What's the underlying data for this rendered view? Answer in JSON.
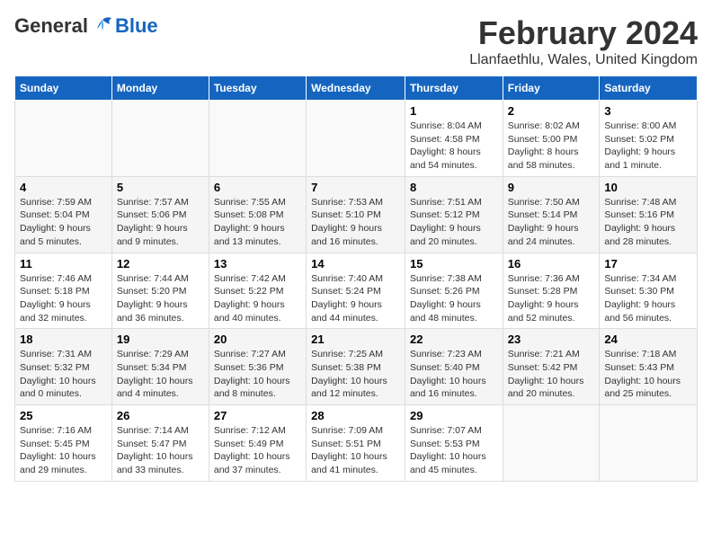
{
  "header": {
    "logo_general": "General",
    "logo_blue": "Blue",
    "month_year": "February 2024",
    "location": "Llanfaethlu, Wales, United Kingdom"
  },
  "days_of_week": [
    "Sunday",
    "Monday",
    "Tuesday",
    "Wednesday",
    "Thursday",
    "Friday",
    "Saturday"
  ],
  "weeks": [
    [
      {
        "day": "",
        "info": ""
      },
      {
        "day": "",
        "info": ""
      },
      {
        "day": "",
        "info": ""
      },
      {
        "day": "",
        "info": ""
      },
      {
        "day": "1",
        "info": "Sunrise: 8:04 AM\nSunset: 4:58 PM\nDaylight: 8 hours\nand 54 minutes."
      },
      {
        "day": "2",
        "info": "Sunrise: 8:02 AM\nSunset: 5:00 PM\nDaylight: 8 hours\nand 58 minutes."
      },
      {
        "day": "3",
        "info": "Sunrise: 8:00 AM\nSunset: 5:02 PM\nDaylight: 9 hours\nand 1 minute."
      }
    ],
    [
      {
        "day": "4",
        "info": "Sunrise: 7:59 AM\nSunset: 5:04 PM\nDaylight: 9 hours\nand 5 minutes."
      },
      {
        "day": "5",
        "info": "Sunrise: 7:57 AM\nSunset: 5:06 PM\nDaylight: 9 hours\nand 9 minutes."
      },
      {
        "day": "6",
        "info": "Sunrise: 7:55 AM\nSunset: 5:08 PM\nDaylight: 9 hours\nand 13 minutes."
      },
      {
        "day": "7",
        "info": "Sunrise: 7:53 AM\nSunset: 5:10 PM\nDaylight: 9 hours\nand 16 minutes."
      },
      {
        "day": "8",
        "info": "Sunrise: 7:51 AM\nSunset: 5:12 PM\nDaylight: 9 hours\nand 20 minutes."
      },
      {
        "day": "9",
        "info": "Sunrise: 7:50 AM\nSunset: 5:14 PM\nDaylight: 9 hours\nand 24 minutes."
      },
      {
        "day": "10",
        "info": "Sunrise: 7:48 AM\nSunset: 5:16 PM\nDaylight: 9 hours\nand 28 minutes."
      }
    ],
    [
      {
        "day": "11",
        "info": "Sunrise: 7:46 AM\nSunset: 5:18 PM\nDaylight: 9 hours\nand 32 minutes."
      },
      {
        "day": "12",
        "info": "Sunrise: 7:44 AM\nSunset: 5:20 PM\nDaylight: 9 hours\nand 36 minutes."
      },
      {
        "day": "13",
        "info": "Sunrise: 7:42 AM\nSunset: 5:22 PM\nDaylight: 9 hours\nand 40 minutes."
      },
      {
        "day": "14",
        "info": "Sunrise: 7:40 AM\nSunset: 5:24 PM\nDaylight: 9 hours\nand 44 minutes."
      },
      {
        "day": "15",
        "info": "Sunrise: 7:38 AM\nSunset: 5:26 PM\nDaylight: 9 hours\nand 48 minutes."
      },
      {
        "day": "16",
        "info": "Sunrise: 7:36 AM\nSunset: 5:28 PM\nDaylight: 9 hours\nand 52 minutes."
      },
      {
        "day": "17",
        "info": "Sunrise: 7:34 AM\nSunset: 5:30 PM\nDaylight: 9 hours\nand 56 minutes."
      }
    ],
    [
      {
        "day": "18",
        "info": "Sunrise: 7:31 AM\nSunset: 5:32 PM\nDaylight: 10 hours\nand 0 minutes."
      },
      {
        "day": "19",
        "info": "Sunrise: 7:29 AM\nSunset: 5:34 PM\nDaylight: 10 hours\nand 4 minutes."
      },
      {
        "day": "20",
        "info": "Sunrise: 7:27 AM\nSunset: 5:36 PM\nDaylight: 10 hours\nand 8 minutes."
      },
      {
        "day": "21",
        "info": "Sunrise: 7:25 AM\nSunset: 5:38 PM\nDaylight: 10 hours\nand 12 minutes."
      },
      {
        "day": "22",
        "info": "Sunrise: 7:23 AM\nSunset: 5:40 PM\nDaylight: 10 hours\nand 16 minutes."
      },
      {
        "day": "23",
        "info": "Sunrise: 7:21 AM\nSunset: 5:42 PM\nDaylight: 10 hours\nand 20 minutes."
      },
      {
        "day": "24",
        "info": "Sunrise: 7:18 AM\nSunset: 5:43 PM\nDaylight: 10 hours\nand 25 minutes."
      }
    ],
    [
      {
        "day": "25",
        "info": "Sunrise: 7:16 AM\nSunset: 5:45 PM\nDaylight: 10 hours\nand 29 minutes."
      },
      {
        "day": "26",
        "info": "Sunrise: 7:14 AM\nSunset: 5:47 PM\nDaylight: 10 hours\nand 33 minutes."
      },
      {
        "day": "27",
        "info": "Sunrise: 7:12 AM\nSunset: 5:49 PM\nDaylight: 10 hours\nand 37 minutes."
      },
      {
        "day": "28",
        "info": "Sunrise: 7:09 AM\nSunset: 5:51 PM\nDaylight: 10 hours\nand 41 minutes."
      },
      {
        "day": "29",
        "info": "Sunrise: 7:07 AM\nSunset: 5:53 PM\nDaylight: 10 hours\nand 45 minutes."
      },
      {
        "day": "",
        "info": ""
      },
      {
        "day": "",
        "info": ""
      }
    ]
  ]
}
